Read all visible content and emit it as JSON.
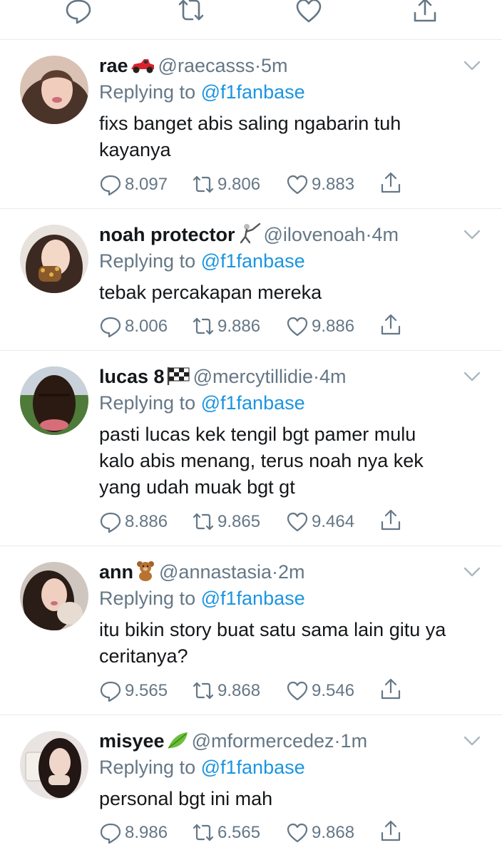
{
  "replies": [
    {
      "name": "rae",
      "emoji_icon": "race-car-icon",
      "handle": "@raecasss",
      "dot": "·",
      "time": "5m",
      "replying_prefix": "Replying to",
      "replying_to": "@f1fanbase",
      "text_lines": [
        "fixs banget abis saling ngabarin tuh",
        "kayanya"
      ],
      "replies_count": "8.097",
      "retweets_count": "9.806",
      "likes_count": "9.883"
    },
    {
      "name": "noah protector",
      "emoji_icon": "fencer-icon",
      "handle": "@ilovenoah",
      "dot": "·",
      "time": "4m",
      "replying_prefix": "Replying to",
      "replying_to": "@f1fanbase",
      "text_lines": [
        "tebak percakapan mereka"
      ],
      "replies_count": "8.006",
      "retweets_count": "9.886",
      "likes_count": "9.886"
    },
    {
      "name": "lucas 8",
      "emoji_icon": "checkered-flag-icon",
      "handle": "@mercytillidie",
      "dot": "·",
      "time": "4m",
      "replying_prefix": "Replying to",
      "replying_to": "@f1fanbase",
      "text_lines": [
        "pasti lucas kek tengil bgt pamer mulu",
        "kalo abis menang, terus noah nya kek",
        "yang udah muak bgt gt"
      ],
      "replies_count": "8.886",
      "retweets_count": "9.865",
      "likes_count": "9.464"
    },
    {
      "name": "ann",
      "emoji_icon": "teddy-bear-icon",
      "handle": "@annastasia",
      "dot": "·",
      "time": "2m",
      "replying_prefix": "Replying to",
      "replying_to": "@f1fanbase",
      "text_lines": [
        "itu bikin story buat satu sama lain gitu ya",
        "ceritanya?"
      ],
      "replies_count": "9.565",
      "retweets_count": "9.868",
      "likes_count": "9.546"
    },
    {
      "name": "misyee",
      "emoji_icon": "leaf-icon",
      "handle": "@mformercedez",
      "dot": "·",
      "time": "1m",
      "replying_prefix": "Replying to",
      "replying_to": "@f1fanbase",
      "text_lines": [
        "personal bgt ini mah"
      ],
      "replies_count": "8.986",
      "retweets_count": "6.565",
      "likes_count": "9.868"
    }
  ],
  "colors": {
    "text": "#14171a",
    "muted": "#657786",
    "link": "#1b95e0",
    "divider": "#e6ecf0"
  }
}
